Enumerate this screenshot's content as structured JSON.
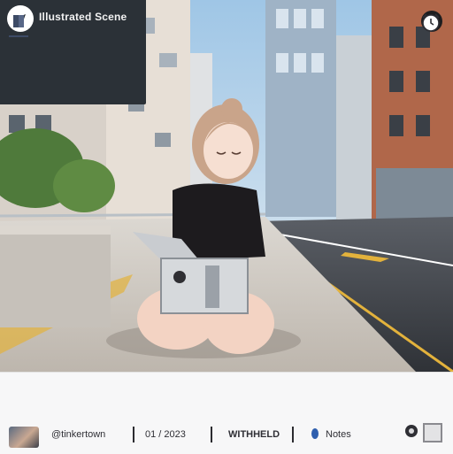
{
  "overlay": {
    "title": "Illustrated Scene"
  },
  "toolbar": {
    "label_one": "@tinkertown",
    "label_two": "01 / 2023",
    "label_three": "WITHHELD",
    "label_four": "Notes"
  },
  "colors": {
    "overlay_bg": "#2b3137",
    "toolbar_bg": "#f7f7f8",
    "accent": "#3d4b66",
    "road_line": "#e3b23c"
  },
  "icons": {
    "overlay_logo": "send-icon",
    "corner_badge": "logo-icon",
    "left_tab": "book-icon",
    "right_action": "alarm-icon",
    "dot": "pin-icon",
    "camera": "camera-icon",
    "square": "square-icon"
  }
}
